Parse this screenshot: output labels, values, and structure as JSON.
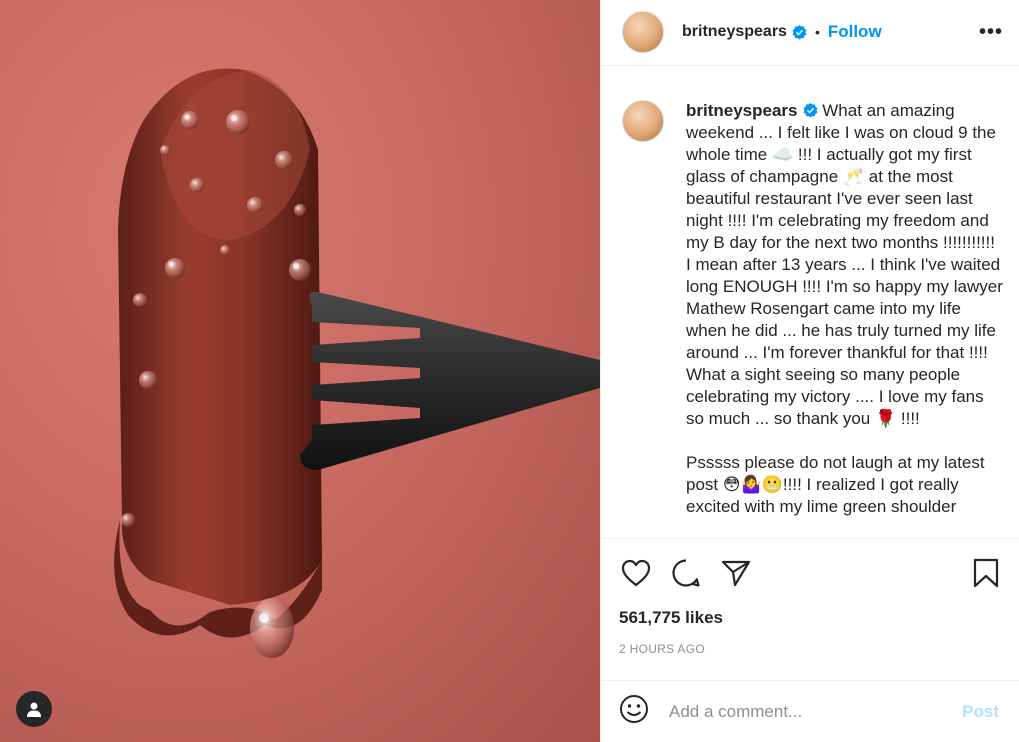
{
  "post": {
    "username": "britneyspears",
    "dot": "•",
    "follow_label": "Follow",
    "more_label": "•••",
    "caption_paragraphs": [
      "What an amazing weekend ... I felt like I was on cloud 9 the whole time ☁️ !!! I actually got my first glass of champagne 🥂 at the most beautiful restaurant I've ever seen last night !!!! I'm celebrating my freedom and my B day for the next two months !!!!!!!!!!! I mean after 13 years ... I think I've waited long ENOUGH !!!! I'm so happy my lawyer Mathew Rosengart came into my life when he did ... he has truly turned my life around ... I'm forever thankful for that !!!! What a sight seeing so many people celebrating my victory .... I love my fans so much ... so thank you 🌹 !!!!",
      "Psssss please do not laugh at my latest post 😳🤷‍♀️😬!!!! I realized I got really excited with my lime green shoulder"
    ],
    "likes": "561,775 likes",
    "timestamp": "2 HOURS AGO",
    "comment_placeholder": "Add a comment...",
    "post_label": "Post"
  },
  "icons": {
    "verified": "verified-badge-icon",
    "heart": "heart-icon",
    "comment": "comment-icon",
    "share": "share-icon",
    "save": "bookmark-icon",
    "emoji": "emoji-icon",
    "tag": "user-tag-icon"
  },
  "colors": {
    "accent": "#0095f6",
    "post_disabled": "#b2dffc",
    "muted": "#8e8e8e",
    "text": "#262626"
  }
}
